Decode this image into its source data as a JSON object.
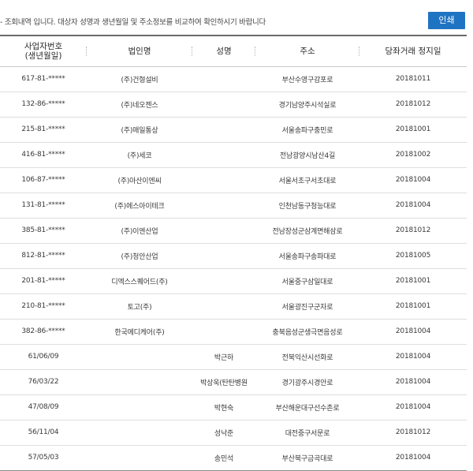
{
  "header": {
    "notice": "- 조회내역 입니다. 대상자 성명과 생년월일 및 주소정보를 비교하여 확인하시기 바랍니다",
    "print_label": "인쇄"
  },
  "table": {
    "columns": [
      "사업자번호\n(생년월일)",
      "법인명",
      "성명",
      "주소",
      "당좌거래 정지일"
    ],
    "rows": [
      [
        "617-81-*****",
        "(주)건형설비",
        "",
        "부산수영구감포로",
        "20181011"
      ],
      [
        "132-86-*****",
        "(주)네오젠스",
        "",
        "경기남양주시석실로",
        "20181012"
      ],
      [
        "215-81-*****",
        "(주)매일통상",
        "",
        "서울송파구충민로",
        "20181001"
      ],
      [
        "416-81-*****",
        "(주)세코",
        "",
        "전남광양시남산4길",
        "20181002"
      ],
      [
        "106-87-*****",
        "(주)아산이엔씨",
        "",
        "서울서초구서초대로",
        "20181004"
      ],
      [
        "131-81-*****",
        "(주)에스아이테크",
        "",
        "인천남동구청능대로",
        "20181004"
      ],
      [
        "385-81-*****",
        "(주)이엔산업",
        "",
        "전남장성군삼계면해삼로",
        "20181012"
      ],
      [
        "812-81-*****",
        "(주)청안산업",
        "",
        "서울송파구송파대로",
        "20181005"
      ],
      [
        "201-81-*****",
        "디엑스스퀘어드(주)",
        "",
        "서울중구삼일대로",
        "20181001"
      ],
      [
        "210-81-*****",
        "토고(주)",
        "",
        "서울광진구군자로",
        "20181001"
      ],
      [
        "382-86-*****",
        "한국메디케어(주)",
        "",
        "충북음성군생극면음성로",
        "20181004"
      ],
      [
        "61/06/09",
        "",
        "박근하",
        "전북익산시선화로",
        "20181004"
      ],
      [
        "76/03/22",
        "",
        "박상욱(탄탄병원",
        "경기광주시경안로",
        "20181004"
      ],
      [
        "47/08/09",
        "",
        "박현숙",
        "부산해운대구선수촌로",
        "20181004"
      ],
      [
        "56/11/04",
        "",
        "성낙준",
        "대전중구서문로",
        "20181012"
      ],
      [
        "57/05/03",
        "",
        "송민석",
        "부산북구금곡대로",
        "20181004"
      ]
    ]
  }
}
